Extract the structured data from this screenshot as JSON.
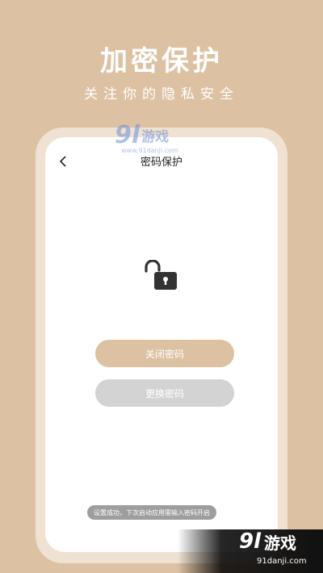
{
  "hero": {
    "title": "加密保护",
    "subtitle": "关注你的隐私安全"
  },
  "screen": {
    "title": "密码保护",
    "close_password_label": "关闭密码",
    "change_password_label": "更换密码",
    "toast": "设置成功，下次启动应用需输入密码开启"
  },
  "watermark": {
    "num": "9l",
    "text": "游戏",
    "url": "www.91danji.com",
    "url_bottom": "91danji.com"
  },
  "colors": {
    "background": "#dcc1a3",
    "frame": "#efe2d2",
    "primary_button": "#dcc1a3",
    "secondary_button": "#d3d3d3",
    "icon": "#333333"
  },
  "icons": {
    "back": "chevron-left-icon",
    "lock": "unlocked-padlock-icon"
  }
}
